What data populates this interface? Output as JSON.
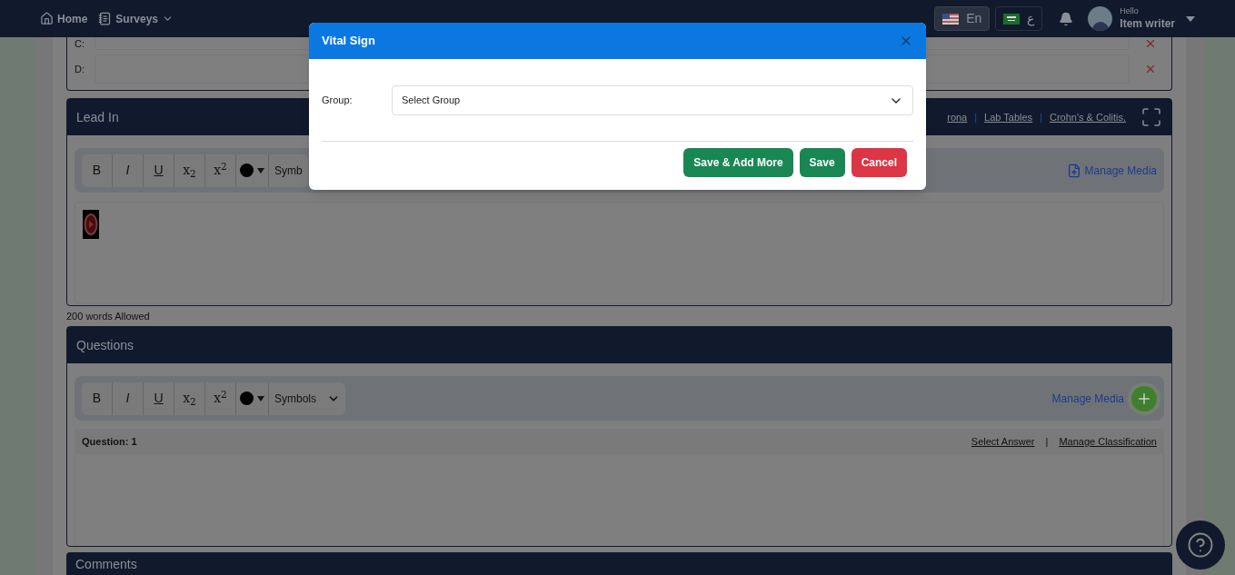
{
  "header": {
    "nav": [
      {
        "label": "Home",
        "kind": "home"
      },
      {
        "label": "Surveys",
        "kind": "menu"
      }
    ],
    "languages": [
      {
        "label": "En",
        "kind": "us",
        "selected": true
      },
      {
        "label": "ع",
        "kind": "sa",
        "selected": false
      }
    ],
    "user": {
      "greeting": "Hello",
      "name": "Item writer"
    }
  },
  "options": [
    {
      "label": "C:"
    },
    {
      "label": "D:"
    }
  ],
  "lead_in": {
    "title": "Lead In",
    "links": [
      "rona",
      "Lab Tables",
      "Crohn's & Colitis."
    ],
    "separator": "|",
    "toolbar": {
      "buttons": [
        "B",
        "I",
        "U",
        "x$_{2}$",
        "x$^{2}$"
      ],
      "symbols": "Symb",
      "manage_media": "Manage Media"
    },
    "word_limit": "200 words Allowed"
  },
  "questions": {
    "title": "Questions",
    "toolbar": {
      "buttons": [
        "B",
        "I",
        "U",
        "x$_{2}$",
        "x$^{2}$"
      ],
      "symbols": "Symbols",
      "manage_media": "Manage Media"
    },
    "question_label": "Question: 1",
    "links": [
      "Select Answer",
      "Manage Classification"
    ],
    "separator": "|"
  },
  "comments": {
    "title": "Comments"
  },
  "dialog": {
    "title": "Vital Sign",
    "field_label": "Group:",
    "placeholder": "Select Group",
    "buttons": [
      {
        "label": "Save & Add More",
        "kind": "primary"
      },
      {
        "label": "Save",
        "kind": "primary"
      },
      {
        "label": "Cancel",
        "kind": "danger"
      }
    ]
  }
}
